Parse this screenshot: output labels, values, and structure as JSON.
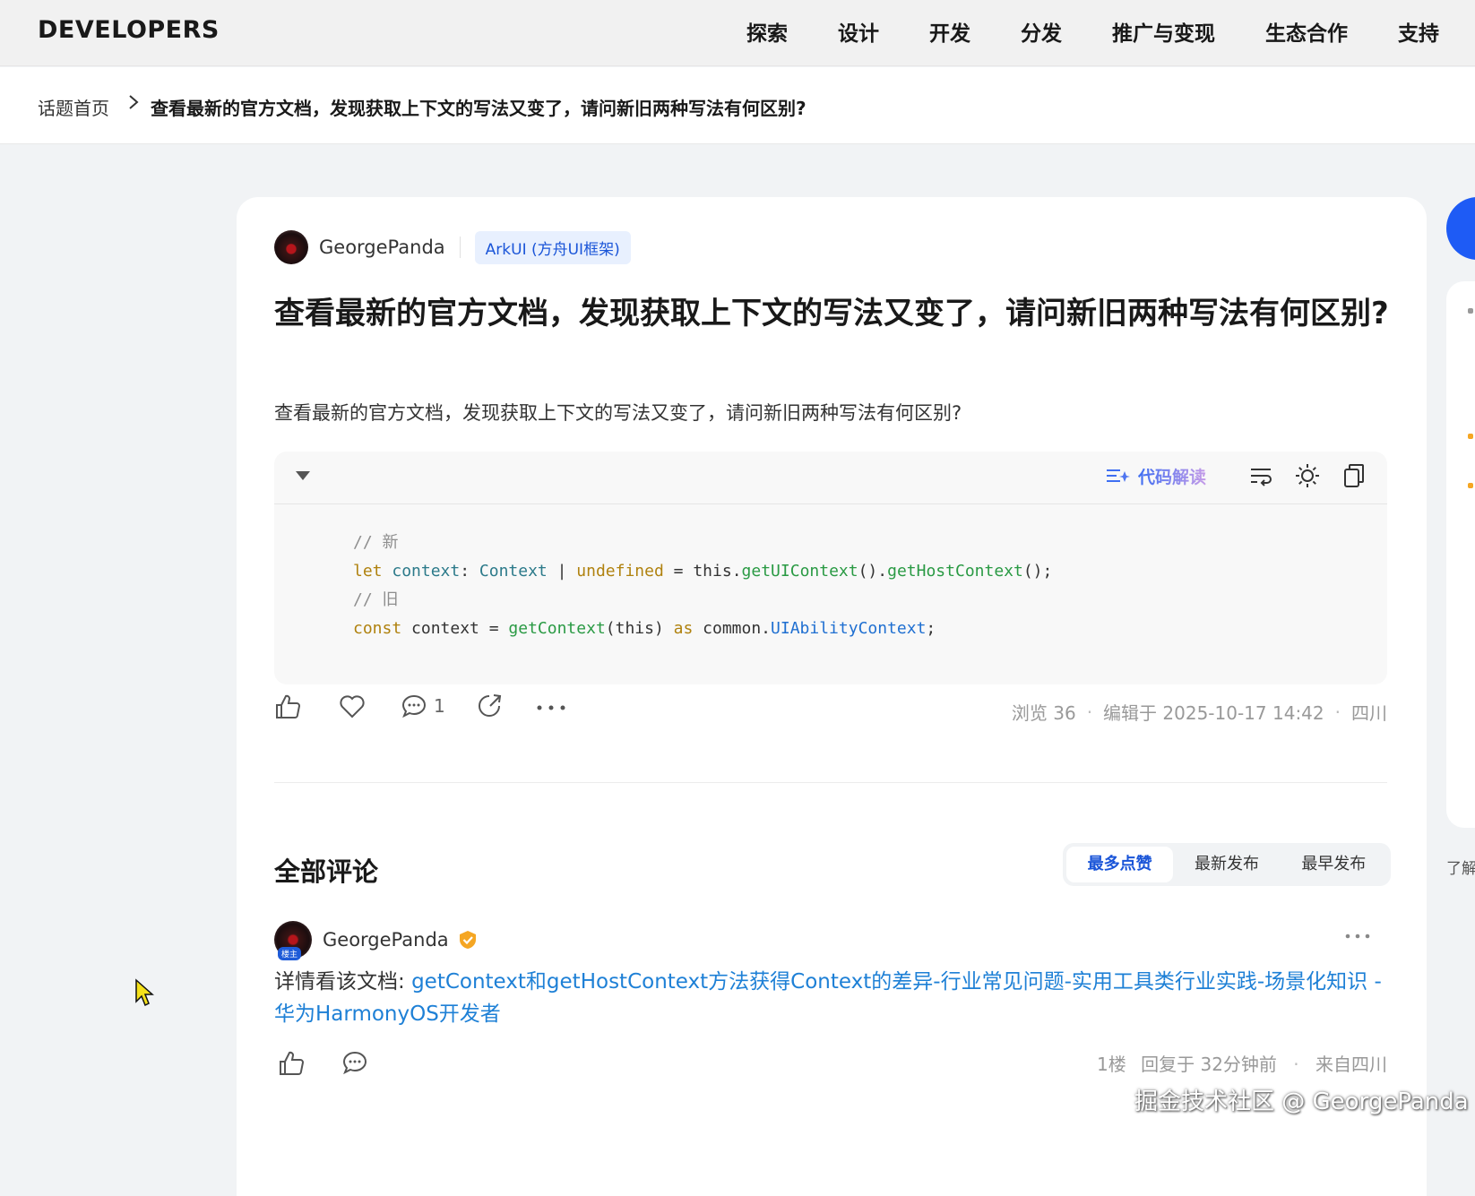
{
  "header": {
    "logo": "DEVELOPERS",
    "nav": [
      "探索",
      "设计",
      "开发",
      "分发",
      "推广与变现",
      "生态合作",
      "支持"
    ]
  },
  "breadcrumb": {
    "home": "话题首页",
    "current": "查看最新的官方文档，发现获取上下文的写法又变了，请问新旧两种写法有何区别?"
  },
  "post": {
    "author": "GeorgePanda",
    "tag": "ArkUI (方舟UI框架)",
    "title": "查看最新的官方文档，发现获取上下文的写法又变了，请问新旧两种写法有何区别?",
    "body": "查看最新的官方文档，发现获取上下文的写法又变了，请问新旧两种写法有何区别?",
    "code_tool_label": "代码解读",
    "code": {
      "line1_comment": "// 新",
      "line2": {
        "kw": "let",
        "var": "context",
        "colon": ":",
        "type": "Context",
        "pipe": " | ",
        "undef": "undefined",
        "eq": " = ",
        "this": "this",
        "dot1": ".",
        "fn1": "getUIContext",
        "call1": "()",
        "dot2": ".",
        "fn2": "getHostContext",
        "tail": "();"
      },
      "line3_comment": "// 旧",
      "line4": {
        "kw": "const",
        "rest1": " context = ",
        "fn": "getContext",
        "args": "(this) ",
        "as": "as",
        "rest2": " common.",
        "cls": "UIAbilityContext",
        "tail": ";"
      }
    },
    "comment_count": "1",
    "meta": {
      "views": "浏览 36",
      "edited": "编辑于 2025-10-17 14:42",
      "location": "四川"
    }
  },
  "comments": {
    "title": "全部评论",
    "sort_tabs": [
      "最多点赞",
      "最新发布",
      "最早发布"
    ],
    "items": [
      {
        "author": "GeorgePanda",
        "avatar_badge": "楼主",
        "prefix": "详情看该文档:",
        "link": "getContext和getHostContext方法获得Context的差异-行业常见问题-实用工具类行业实践-场景化知识 - 华为HarmonyOS开发者",
        "floor": "1楼",
        "reply_time": "回复于 32分钟前",
        "from": "来自四川"
      }
    ]
  },
  "watermark": "掘金技术社区 @ GeorgePanda",
  "side": {
    "text": "了解"
  },
  "colors": {
    "brand_blue": "#1e5bf5",
    "link": "#1e80d6",
    "tag_bg": "#e8f0fe"
  }
}
